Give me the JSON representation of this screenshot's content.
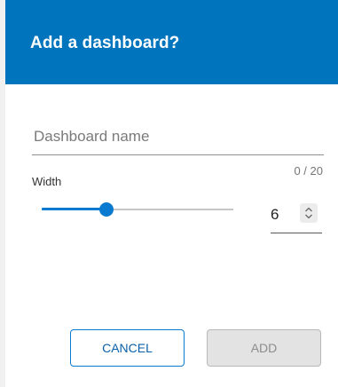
{
  "dialog": {
    "title": "Add a dashboard?"
  },
  "name_field": {
    "placeholder": "Dashboard name",
    "value": "",
    "char_count": "0 / 20"
  },
  "width_control": {
    "label": "Width",
    "value": "6",
    "min": 1,
    "max": 12,
    "slider_fraction": 0.34
  },
  "buttons": {
    "cancel_label": "CANCEL",
    "add_label": "ADD",
    "add_enabled": false
  },
  "colors": {
    "header": "#0074bd",
    "accent": "#0a7ad1"
  },
  "icons": {
    "stepper": "up-down-chevron-icon"
  }
}
